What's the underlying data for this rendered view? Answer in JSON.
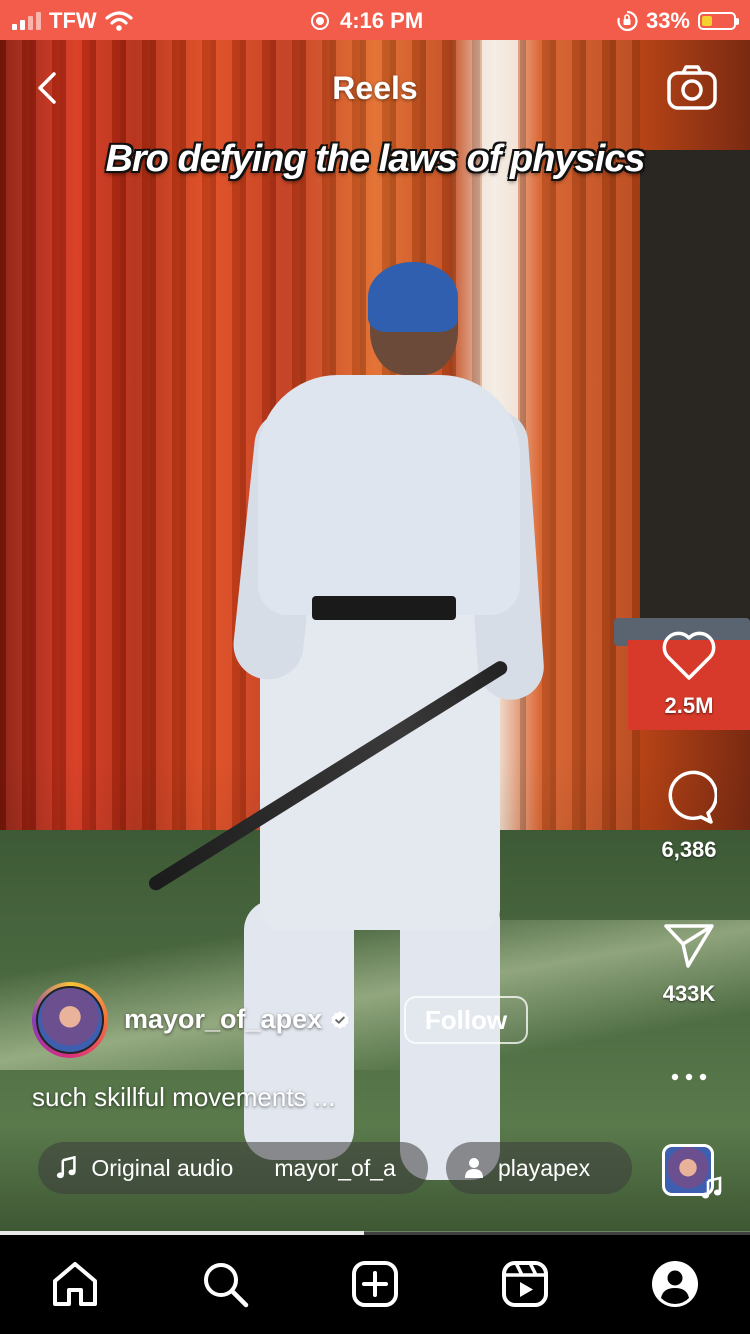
{
  "status_bar": {
    "carrier": "TFW",
    "time": "4:16 PM",
    "battery_percent": "33%",
    "battery_level": 0.33,
    "bar_color": "#f35b4a"
  },
  "header": {
    "title": "Reels",
    "back_icon": "chevron-left-icon",
    "camera_icon": "camera-icon"
  },
  "video": {
    "overlay_caption": "Bro defying the laws of physics",
    "progress": 0.485
  },
  "actions": {
    "like_count": "2.5M",
    "comment_count": "6,386",
    "share_count": "433K",
    "more_icon": "more-horizontal-icon"
  },
  "author": {
    "username": "mayor_of_apex",
    "verified": true,
    "follow_label": "Follow"
  },
  "post": {
    "caption": "such skillful movements ..."
  },
  "audio": {
    "label": "Original audio",
    "artist": "mayor_of_a",
    "collaborator": "playapex"
  },
  "tab_bar": {
    "items": [
      "home-icon",
      "search-icon",
      "create-icon",
      "reels-icon",
      "profile-icon"
    ]
  }
}
